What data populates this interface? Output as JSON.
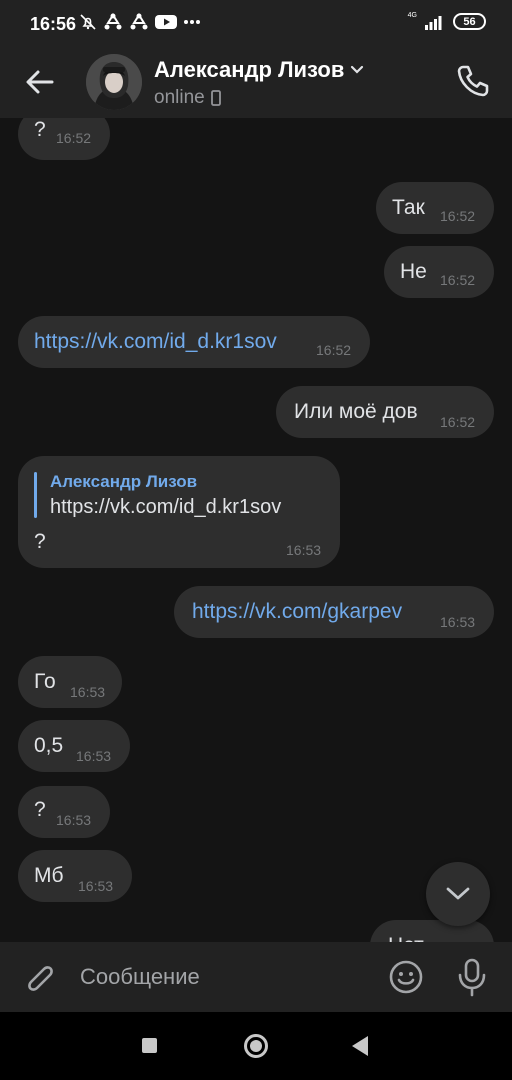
{
  "status_bar": {
    "time": "16:56",
    "network": "4G",
    "battery": "56",
    "icons": [
      "silent-alarm-icon",
      "recycle-icon",
      "recycle-icon",
      "youtube-icon",
      "more-dots-icon",
      "signal-icon",
      "battery-icon"
    ]
  },
  "header": {
    "back_icon": "arrow-left-icon",
    "title": "Александр Лизов",
    "status": "online",
    "status_icon": "phone-device-icon",
    "call_icon": "phone-icon"
  },
  "messages": [
    {
      "side": "in",
      "text": "?",
      "time": "16:52"
    },
    {
      "side": "out",
      "text": "Так",
      "time": "16:52"
    },
    {
      "side": "out",
      "text": "Не",
      "time": "16:52"
    },
    {
      "side": "in",
      "text": "https://vk.com/id_d.kr1sov",
      "time": "16:52",
      "is_link": true
    },
    {
      "side": "out",
      "text": "Или моё дов",
      "time": "16:52"
    },
    {
      "side": "in",
      "reply_to": {
        "name": "Александр Лизов",
        "text": "https://vk.com/id_d.kr1sov"
      },
      "text": "?",
      "time": "16:53"
    },
    {
      "side": "out",
      "text": "https://vk.com/gkarpev",
      "time": "16:53",
      "is_link": true
    },
    {
      "side": "in",
      "text": "Го",
      "time": "16:53"
    },
    {
      "side": "in",
      "text": "0,5",
      "time": "16:53"
    },
    {
      "side": "in",
      "text": "?",
      "time": "16:53"
    },
    {
      "side": "in",
      "text": "Мб",
      "time": "16:53"
    },
    {
      "side": "out",
      "text": "Нет",
      "time": ""
    }
  ],
  "composer": {
    "placeholder": "Сообщение",
    "attach_icon": "paperclip-icon",
    "emoji_icon": "smile-icon",
    "mic_icon": "microphone-icon"
  },
  "colors": {
    "background": "#141414",
    "bar": "#222222",
    "bubble": "#2e2e2e",
    "text": "#e1e3e6",
    "link": "#71aaeb",
    "time": "#76787a"
  }
}
